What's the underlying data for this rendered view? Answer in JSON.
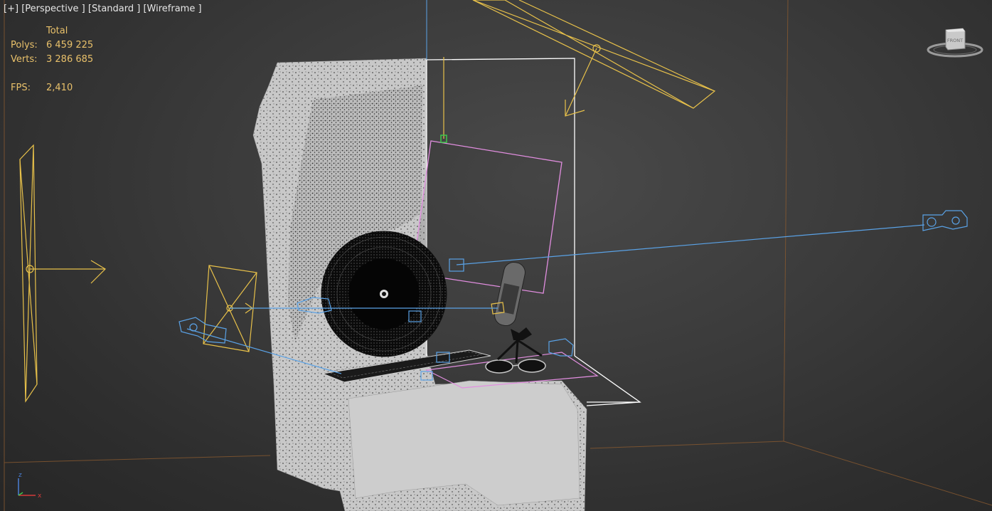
{
  "viewport": {
    "labels": {
      "plus": "[+]",
      "view": "[Perspective ]",
      "shading_standard": "[Standard ]",
      "shading_mode": "[Wireframe ]"
    },
    "stats": {
      "header": "Total",
      "polys_label": "Polys:",
      "polys_value": "6 459 225",
      "verts_label": "Verts:",
      "verts_value": "3 286 685",
      "fps_label": "FPS:",
      "fps_value": "2,410"
    },
    "viewcube": {
      "face_label": "FRONT"
    },
    "axis_tripod": {
      "z": "z",
      "x": "x"
    }
  },
  "colors": {
    "light_yellow": "#e8c14a",
    "camera_blue": "#5aa2e6",
    "selection_pink": "#e28ee0",
    "stats_gold": "#e8c06a",
    "room_edge": "#8a5a30"
  },
  "icons": [
    "viewcube-icon",
    "axis-tripod-icon",
    "camera-icon",
    "light-icon"
  ]
}
